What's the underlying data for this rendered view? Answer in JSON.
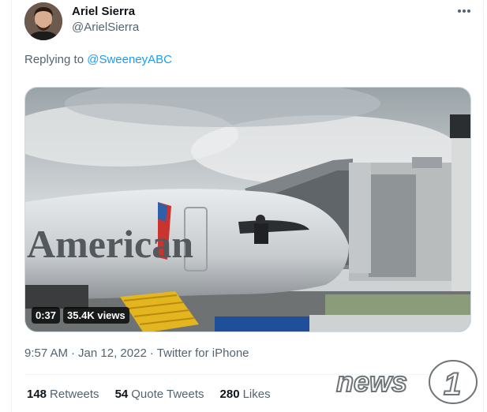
{
  "author": {
    "name": "Ariel Sierra",
    "handle": "@ArielSierra"
  },
  "reply": {
    "prefix": "Replying to ",
    "mention": "@SweeneyABC"
  },
  "media": {
    "duration": "0:37",
    "views": "35.4K views",
    "plane_text": "American"
  },
  "meta": {
    "time": "9:57 AM",
    "date": "Jan 12, 2022",
    "source": "Twitter for iPhone",
    "separator": "·"
  },
  "stats": {
    "retweets_count": "148",
    "retweets_label": "Retweets",
    "quotes_count": "54",
    "quotes_label": "Quote Tweets",
    "likes_count": "280",
    "likes_label": "Likes"
  },
  "watermark": {
    "text": "news",
    "number": "1"
  },
  "colors": {
    "link": "#1d9bf0",
    "secondary": "#536471",
    "primary": "#0f1419"
  }
}
